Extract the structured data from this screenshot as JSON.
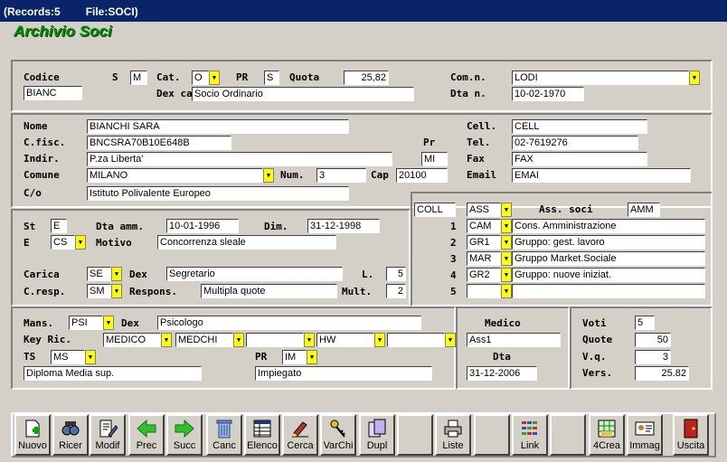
{
  "window": {
    "records": "(Records:5",
    "file": "File:SOCI)"
  },
  "app_title": "Archivio Soci",
  "header": {
    "codice_label": "Codice",
    "codice": "BIANC",
    "s_label": "S",
    "s": "M",
    "cat_label": "Cat.",
    "cat": "O",
    "pr_label": "PR",
    "pr": "S",
    "quota_label": "Quota",
    "quota": "25,82",
    "dex_cat_label": "Dex ca",
    "dex_cat": "Socio Ordinario",
    "comn_label": "Com.n.",
    "comn": "LODI",
    "dtan_label": "Dta n.",
    "dtan": "10-02-1970"
  },
  "person": {
    "nome_label": "Nome",
    "nome": "BIANCHI SARA",
    "cfisc_label": "C.fisc.",
    "cfisc": "BNCSRA70B10E648B",
    "indir_label": "Indir.",
    "indir": "P.za Liberta'",
    "pr_label": "Pr",
    "pr": "MI",
    "comune_label": "Comune",
    "comune": "MILANO",
    "num_label": "Num.",
    "num": "3",
    "cap_label": "Cap",
    "cap": "20100",
    "co_label": "C/o",
    "co": "Istituto Polivalente Europeo",
    "cell_label": "Cell.",
    "cell": "CELL",
    "tel_label": "Tel.",
    "tel": "02-7619276",
    "fax_label": "Fax",
    "fax": "FAX",
    "email_label": "Email",
    "email": "EMAI"
  },
  "status": {
    "st_label": "St",
    "st": "E",
    "dta_amm_label": "Dta amm.",
    "dta_amm": "10-01-1996",
    "dim_label": "Dim.",
    "dim": "31-12-1998",
    "e_label": "E",
    "e": "CS",
    "motivo_label": "Motivo",
    "motivo": "Concorrenza sleale",
    "carica_label": "Carica",
    "carica": "SE",
    "dex_label": "Dex",
    "dex": "Segretario",
    "l_label": "L.",
    "l": "5",
    "cresp_label": "C.resp.",
    "cresp": "SM",
    "respons_label": "Respons.",
    "respons": "Multipla quote",
    "mult_label": "Mult.",
    "mult": "2"
  },
  "assoc": {
    "coll": "COLL",
    "ass": "ASS",
    "label": "Ass. soci",
    "amm": "AMM",
    "rows": [
      {
        "n": "1",
        "code": "CAM",
        "desc": "Cons. Amministrazione"
      },
      {
        "n": "2",
        "code": "GR1",
        "desc": "Gruppo: gest. lavoro"
      },
      {
        "n": "3",
        "code": "MAR",
        "desc": "Gruppo Market.Sociale"
      },
      {
        "n": "4",
        "code": "GR2",
        "desc": "Gruppo: nuove iniziat."
      },
      {
        "n": "5",
        "code": "",
        "desc": ""
      }
    ]
  },
  "job": {
    "mans_label": "Mans.",
    "mans": "PSI",
    "dex_label": "Dex",
    "dex": "Psicologo",
    "keyric_label": "Key Ric.",
    "key1": "MEDICO",
    "key2": "MEDCHI",
    "key3": "",
    "key4": "HW",
    "key5": "",
    "ts_label": "TS",
    "ts": "MS",
    "pr_label": "PR",
    "pr": "IM",
    "ts_desc": "Diploma Media sup.",
    "pr_desc": "Impiegato"
  },
  "medico": {
    "label": "Medico",
    "value": "Ass1",
    "dta_label": "Dta",
    "dta": "31-12-2006"
  },
  "votes": {
    "voti_label": "Voti",
    "voti": "5",
    "quote_label": "Quote",
    "quote": "50",
    "vq_label": "V.q.",
    "vq": "3",
    "vers_label": "Vers.",
    "vers": "25.82"
  },
  "toolbar": {
    "nuovo": "Nuovo",
    "ricer": "Ricer",
    "modif": "Modif",
    "prec": "Prec",
    "succ": "Succ",
    "canc": "Canc",
    "elenco": "Elenco",
    "cerca": "Cerca",
    "varchi": "VarChi",
    "dupl": "Dupl",
    "liste": "Liste",
    "link": "Link",
    "crea": "4Crea",
    "immag": "Immag",
    "uscita": "Uscita"
  },
  "colors": {
    "title_green": "#078a07",
    "dropdown_yellow": "#ffff00",
    "titlebar": "#0a246a"
  }
}
